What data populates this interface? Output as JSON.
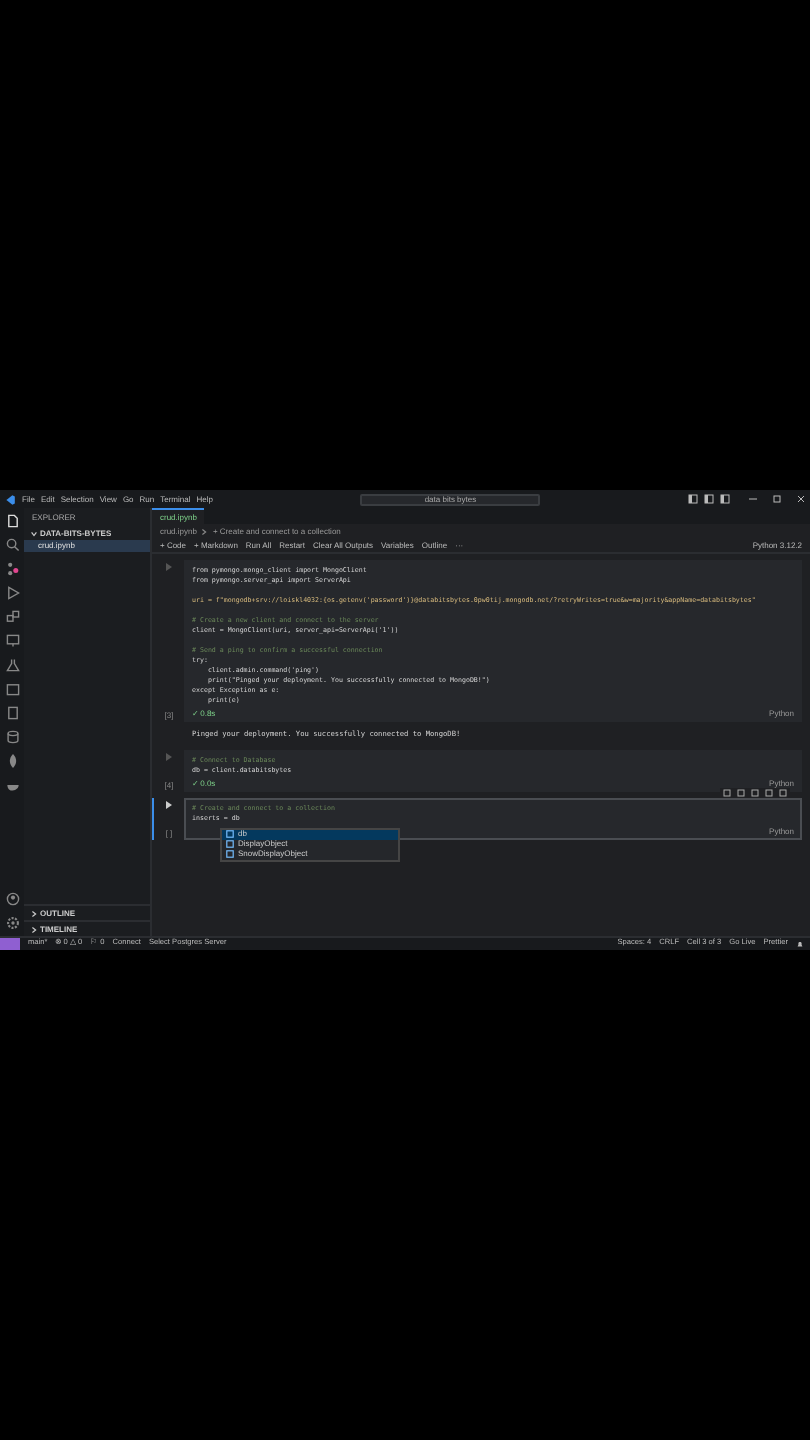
{
  "menu": [
    "File",
    "Edit",
    "Selection",
    "View",
    "Go",
    "Run",
    "Terminal",
    "Help"
  ],
  "window": {
    "title": "data bits bytes"
  },
  "sidebar": {
    "title": "EXPLORER",
    "folder": "DATA-BITS-BYTES",
    "files": [
      {
        "name": "crud.ipynb",
        "selected": true
      }
    ],
    "sections": [
      "OUTLINE",
      "TIMELINE"
    ]
  },
  "tabs": [
    {
      "label": "crud.ipynb",
      "selected": true
    }
  ],
  "breadcrumb": [
    "crud.ipynb",
    "+ Create and connect to a collection"
  ],
  "toolbar": [
    "+ Code",
    "+ Markdown",
    "Run All",
    "Restart",
    "Clear All Outputs",
    "Variables",
    "Outline",
    "···"
  ],
  "kernel": "Python 3.12.2",
  "cells": [
    {
      "selected": false,
      "count": "[3]",
      "status": "✓ 0.8s",
      "language": "Python",
      "lines": [
        {
          "kind": "code",
          "text": "from pymongo.mongo_client import MongoClient"
        },
        {
          "kind": "code",
          "text": "from pymongo.server_api import ServerApi"
        },
        {
          "kind": "blank"
        },
        {
          "kind": "string",
          "text": "uri = f\"mongodb+srv://loiskl4032:{os.getenv('password')}@databitsbytes.0pw0tij.mongodb.net/?retryWrites=true&w=majority&appName=databitsbytes\""
        },
        {
          "kind": "blank"
        },
        {
          "kind": "comment",
          "text": "# Create a new client and connect to the server"
        },
        {
          "kind": "code",
          "text": "client = MongoClient(uri, server_api=ServerApi('1'))"
        },
        {
          "kind": "blank"
        },
        {
          "kind": "comment",
          "text": "# Send a ping to confirm a successful connection"
        },
        {
          "kind": "code",
          "text": "try:"
        },
        {
          "kind": "code",
          "text": "    client.admin.command('ping')"
        },
        {
          "kind": "code",
          "text": "    print(\"Pinged your deployment. You successfully connected to MongoDB!\")"
        },
        {
          "kind": "code",
          "text": "except Exception as e:"
        },
        {
          "kind": "code",
          "text": "    print(e)"
        }
      ],
      "output": "Pinged your deployment. You successfully connected to MongoDB!"
    },
    {
      "selected": false,
      "count": "[4]",
      "status": "✓ 0.0s",
      "language": "Python",
      "lines": [
        {
          "kind": "comment",
          "text": "# Connect to Database"
        },
        {
          "kind": "code",
          "text": "db = client.databitsbytes"
        }
      ]
    },
    {
      "selected": true,
      "count": "[ ]",
      "language": "Python",
      "lines": [
        {
          "kind": "comment",
          "text": "# Create and connect to a collection"
        },
        {
          "kind": "code",
          "text": "inserts = db"
        }
      ],
      "suggestions": [
        {
          "label": "db",
          "selected": true
        },
        {
          "label": "DisplayObject",
          "selected": false
        },
        {
          "label": "SnowDisplayObject",
          "selected": false
        }
      ]
    }
  ],
  "status_bar": {
    "left": [
      "main*",
      "⊗ 0 △ 0",
      "⚐ 0",
      "Connect",
      "Select Postgres Server"
    ],
    "right": [
      "Spaces: 4",
      "CRLF",
      "Cell 3 of 3",
      "Go Live",
      "Prettier"
    ]
  }
}
